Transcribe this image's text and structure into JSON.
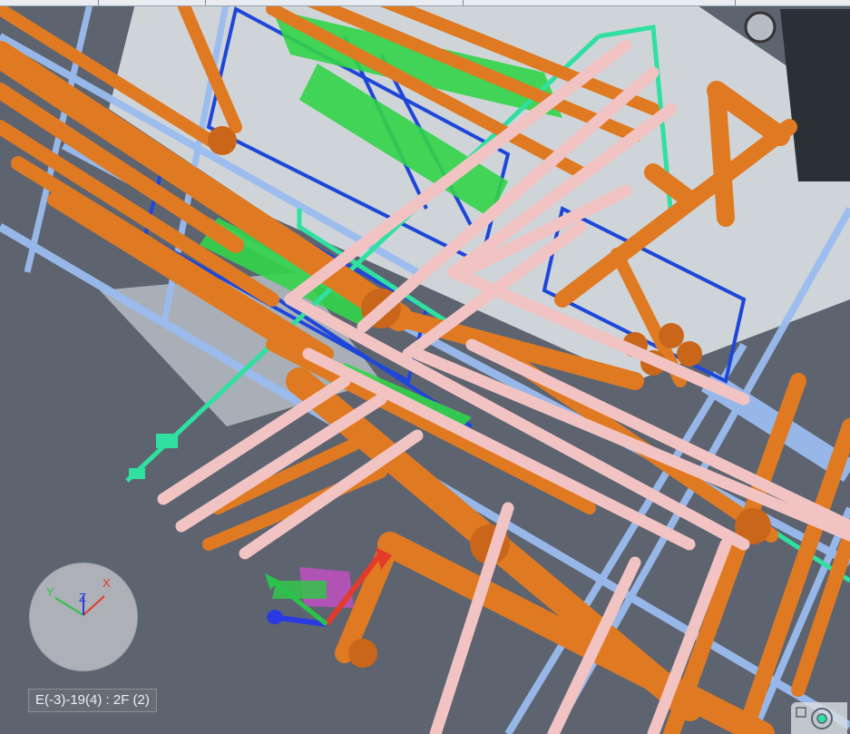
{
  "viewer": {
    "location_label": "E(-3)-19(4) : 2F (2)"
  },
  "axes": {
    "x_label": "X",
    "y_label": "Y",
    "z_label": "Z"
  },
  "colors": {
    "background": "#5d6470",
    "floor_tile": "#d9dde2",
    "orange_pipe": "#e07a22",
    "pink_pipe": "#f2c3c3",
    "green_line": "#2fe0a0",
    "blue_frame": "#1e46d8",
    "steel_beam": "#9bbcf0",
    "valve_green": "#33d44a",
    "axis_x": "#e33a2a",
    "axis_y": "#2ac44a",
    "axis_z": "#2a3ae3"
  },
  "icons": {
    "compass": "axis-compass-icon",
    "manipulator": "transform-gizmo-icon",
    "corner": "view-cube-icon"
  }
}
